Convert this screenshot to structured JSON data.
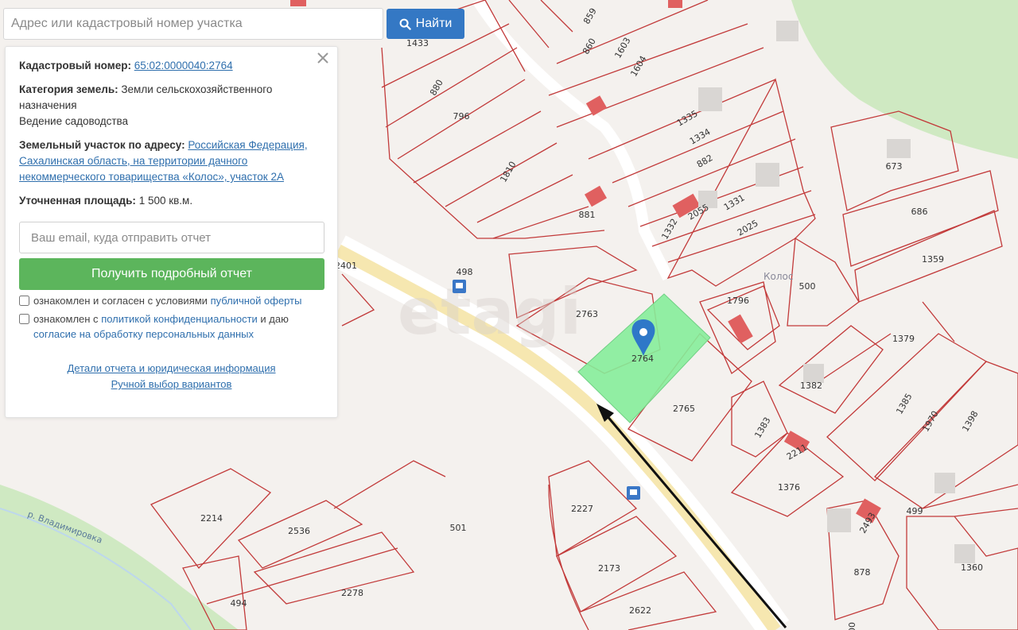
{
  "search": {
    "placeholder": "Адрес или кадастровый номер участка",
    "button_label": "Найти"
  },
  "info_panel": {
    "cadastral_label": "Кадастровый номер:",
    "cadastral_value": "65:02:0000040:2764",
    "category_label": "Категория земель:",
    "category_value": "Земли сельскохозяйственного назначения",
    "category_use": "Ведение садоводства",
    "address_label": "Земельный участок по адресу:",
    "address_value": "Российская Федерация, Сахалинская область, на территории дачного некоммерческого товарищества «Колос», участок 2А",
    "area_label": "Уточненная площадь:",
    "area_value": "1 500 кв.м.",
    "email_placeholder": "Ваш email, куда отправить отчет",
    "get_report_label": "Получить подробный отчет",
    "offer_text": "ознакомлен и согласен с условиями",
    "offer_link": "публичной оферты",
    "privacy_text_1": "ознакомлен с",
    "privacy_link": "политикой конфиденциальности",
    "privacy_text_2": "и даю",
    "consent_link": "согласие на обработку персональных данных",
    "details_link": "Детали отчета и юридическая информация",
    "manual_link": "Ручной выбор вариантов"
  },
  "map": {
    "selected_parcel": "2764",
    "watermark": "etagi",
    "settlement_label": "Колос",
    "river_label": "р. Владимировка",
    "highlight_color": "#86ed9a",
    "parcel_stroke_color": "#c23a3a",
    "parcels": [
      "2765",
      "1433",
      "880",
      "796",
      "1810",
      "881",
      "859",
      "860",
      "1603",
      "1604",
      "1335",
      "1334",
      "882",
      "1332",
      "2055",
      "1331",
      "2025",
      "1796",
      "673",
      "686",
      "1359",
      "500",
      "1379",
      "1382",
      "1385",
      "1970",
      "1398",
      "1383",
      "2211",
      "1376",
      "499",
      "2493",
      "878",
      "1360",
      "2763",
      "498",
      "2401",
      "501",
      "2227",
      "2173",
      "2622",
      "2214",
      "2536",
      "2278",
      "494",
      "00"
    ]
  }
}
